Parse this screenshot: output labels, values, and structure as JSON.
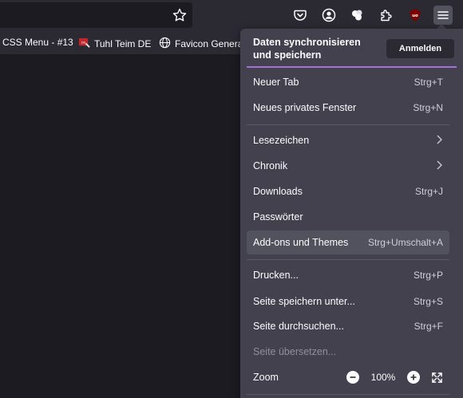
{
  "bookmarks": [
    {
      "label": "CSS Menu - #13"
    },
    {
      "label": "Tuhl Teim DE"
    },
    {
      "label": "Favicon Generat"
    }
  ],
  "menu": {
    "sync_title": "Daten synchronisieren und speichern",
    "sync_button": "Anmelden",
    "items": [
      {
        "label": "Neuer Tab",
        "shortcut": "Strg+T"
      },
      {
        "label": "Neues privates Fenster",
        "shortcut": "Strg+N"
      },
      {
        "label": "Lesezeichen"
      },
      {
        "label": "Chronik"
      },
      {
        "label": "Downloads",
        "shortcut": "Strg+J"
      },
      {
        "label": "Passwörter"
      },
      {
        "label": "Add-ons und Themes",
        "shortcut": "Strg+Umschalt+A"
      },
      {
        "label": "Drucken...",
        "shortcut": "Strg+P"
      },
      {
        "label": "Seite speichern unter...",
        "shortcut": "Strg+S"
      },
      {
        "label": "Seite durchsuchen...",
        "shortcut": "Strg+F"
      },
      {
        "label": "Seite übersetzen..."
      },
      {
        "label": "Zoom",
        "zoom_value": "100%"
      }
    ]
  },
  "colors": {
    "accent_line": "#a770d9",
    "ublock": "#800000"
  }
}
